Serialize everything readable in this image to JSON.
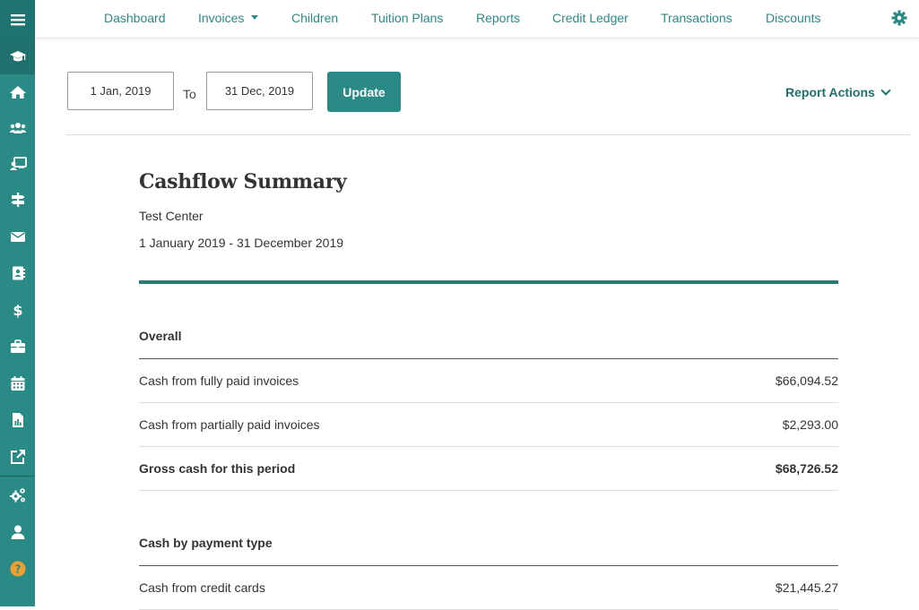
{
  "nav": {
    "items": [
      "Dashboard",
      "Invoices",
      "Children",
      "Tuition Plans",
      "Reports",
      "Credit Ledger",
      "Transactions",
      "Discounts"
    ]
  },
  "filters": {
    "start_date": "1 Jan, 2019",
    "to_label": "To",
    "end_date": "31 Dec, 2019",
    "update_label": "Update",
    "report_actions_label": "Report Actions"
  },
  "report": {
    "title": "Cashflow Summary",
    "center": "Test Center",
    "period": "1 January 2019 - 31 December 2019",
    "overall": {
      "heading": "Overall",
      "rows": [
        {
          "label": "Cash from fully paid invoices",
          "value": "$66,094.52"
        },
        {
          "label": "Cash from partially paid invoices",
          "value": "$2,293.00"
        },
        {
          "label": "Gross cash for this period",
          "value": "$68,726.52"
        }
      ]
    },
    "by_payment_type": {
      "heading": "Cash by payment type",
      "rows": [
        {
          "label": "Cash from credit cards",
          "value": "$21,445.27"
        }
      ]
    }
  },
  "colors": {
    "accent": "#2a8a86",
    "sidebar": "#2a8a86",
    "help_icon": "#f0a030"
  },
  "sidebar_icons": [
    "menu-icon",
    "graduation-cap-icon",
    "home-icon",
    "users-icon",
    "teacher-icon",
    "signpost-icon",
    "envelope-icon",
    "address-book-icon",
    "dollar-icon",
    "briefcase-icon",
    "calendar-icon",
    "report-file-icon",
    "external-link-icon",
    "settings-cogs-icon",
    "user-icon",
    "help-icon"
  ]
}
